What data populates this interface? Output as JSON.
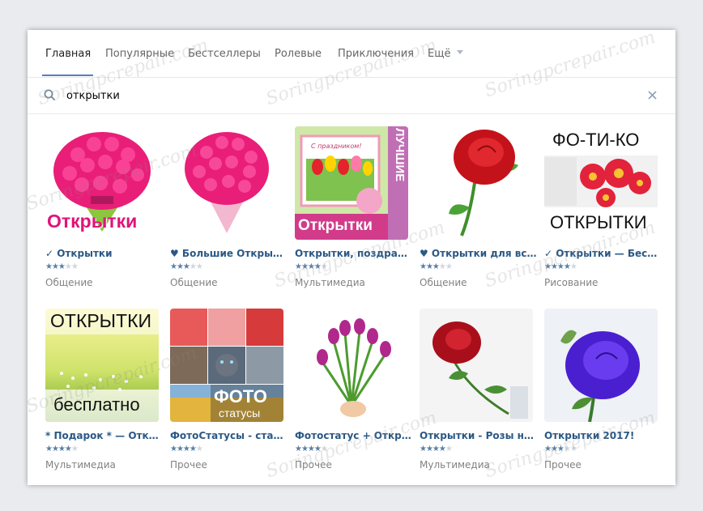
{
  "tabs": [
    "Главная",
    "Популярные",
    "Бестселлеры",
    "Ролевые",
    "Приключения",
    "Ещё"
  ],
  "search": {
    "value": "открытки",
    "placeholder": ""
  },
  "apps": [
    {
      "name": "✓ Открытки",
      "rating": 3.5,
      "category": "Общение",
      "overlay": "Открытки"
    },
    {
      "name": "♥ Большие Открытки",
      "rating": 3.5,
      "category": "Общение",
      "overlay": ""
    },
    {
      "name": "Открытки, поздравл...",
      "rating": 4,
      "category": "Мультимедиа",
      "overlay": "Открытки"
    },
    {
      "name": "♥ Открытки для всех",
      "rating": 3.5,
      "category": "Общение",
      "overlay": ""
    },
    {
      "name": "✓ Открытки — Беспл...",
      "rating": 4,
      "category": "Рисование",
      "overlay_top": "ФО-ТИ-КО",
      "overlay_bottom": "ОТКРЫТКИ"
    },
    {
      "name": "* Подарок * — Откры...",
      "rating": 4,
      "category": "Мультимедиа",
      "overlay_top": "ОТКРЫТКИ",
      "overlay_bottom": "бесплатно"
    },
    {
      "name": "ФотоСтатусы - стату...",
      "rating": 4,
      "category": "Прочее",
      "overlay_top": "ФОТО",
      "overlay_bottom": "статусы"
    },
    {
      "name": "Фотостатус + Откры...",
      "rating": 4,
      "category": "Прочее",
      "overlay": ""
    },
    {
      "name": "Открытки - Розы на ...",
      "rating": 4,
      "category": "Мультимедиа",
      "overlay": ""
    },
    {
      "name": "Открытки 2017!",
      "rating": 3.5,
      "category": "Прочее",
      "overlay": ""
    }
  ],
  "thumb3": {
    "top_label": "ЛУЧШИЕ",
    "card_text": "С праздником!"
  },
  "watermark": "Soringpcrepair.com",
  "colors": {
    "accent": "#5181b8",
    "link": "#2a5885",
    "muted": "#828282"
  }
}
